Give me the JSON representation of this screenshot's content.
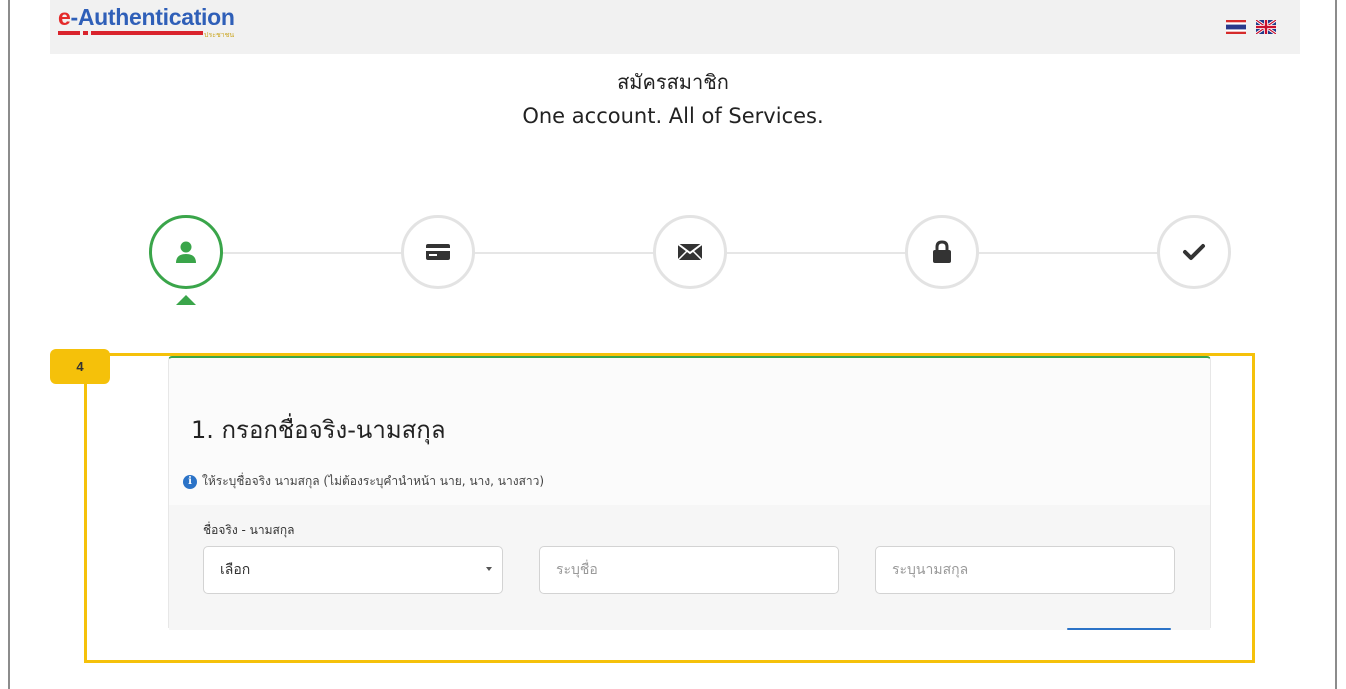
{
  "navbar": {
    "logo_text": "e-Authentication",
    "logo_subtext": "ประชาชน",
    "languages": [
      "TH",
      "EN"
    ]
  },
  "header": {
    "title_th": "สมัครสมาชิก",
    "title_en": "One account. All of Services."
  },
  "stepper": {
    "active_index": 0,
    "steps": [
      {
        "icon": "user-icon"
      },
      {
        "icon": "id-card-icon"
      },
      {
        "icon": "envelope-icon"
      },
      {
        "icon": "lock-icon"
      },
      {
        "icon": "checkmark-icon"
      }
    ]
  },
  "annotation": {
    "badge": "4",
    "color": "#f5c10a"
  },
  "form": {
    "title": "1. กรอกชื่อจริง-นามสกุล",
    "info": "ให้ระบุชื่อจริง นามสกุล (ไม่ต้องระบุคำนำหน้า นาย, นาง, นางสาว)",
    "field_label": "ชื่อจริง - นามสกุล",
    "prefix_select": "เลือก",
    "first_name_placeholder": "ระบุชื่อ",
    "last_name_placeholder": "ระบุนามสกุล"
  },
  "colors": {
    "accent_green": "#3aa54a",
    "brand_blue": "#2f5fb8",
    "brand_red": "#e42a2a",
    "info_blue": "#2b73c7"
  }
}
